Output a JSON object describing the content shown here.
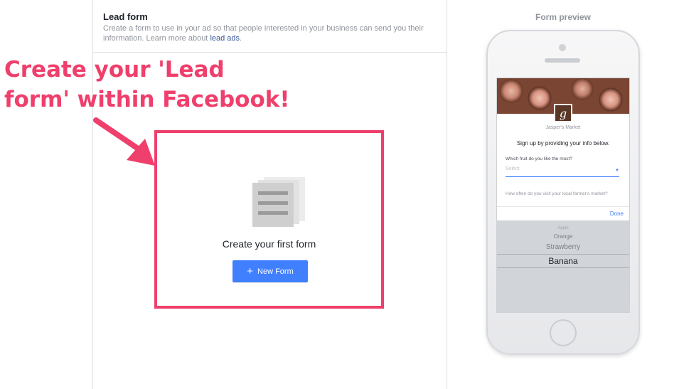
{
  "header": {
    "title": "Lead form",
    "description": "Create a form to use in your ad so that people interested in your business can send you their information. Learn more about",
    "link_label": "lead ads",
    "link_suffix": "."
  },
  "annotation": {
    "line1": "Create your 'Lead",
    "line2": "form' within Facebook!"
  },
  "create_form": {
    "title": "Create your first form",
    "button_label": "New Form",
    "button_icon": "plus-icon"
  },
  "preview": {
    "title": "Form preview",
    "logo_letter": "g",
    "business_name": "Jasper's Market",
    "signup_text": "Sign up by providing your info below.",
    "question1": "Which fruit do you like the most?",
    "select_placeholder": "Select",
    "question2": "How often do you visit your local farmer's market?",
    "done_label": "Done",
    "picker_options": [
      "Apple",
      "Orange",
      "Strawberry",
      "Banana"
    ]
  },
  "colors": {
    "accent": "#4080ff",
    "annotation": "#ef3f6c",
    "link": "#365899"
  }
}
